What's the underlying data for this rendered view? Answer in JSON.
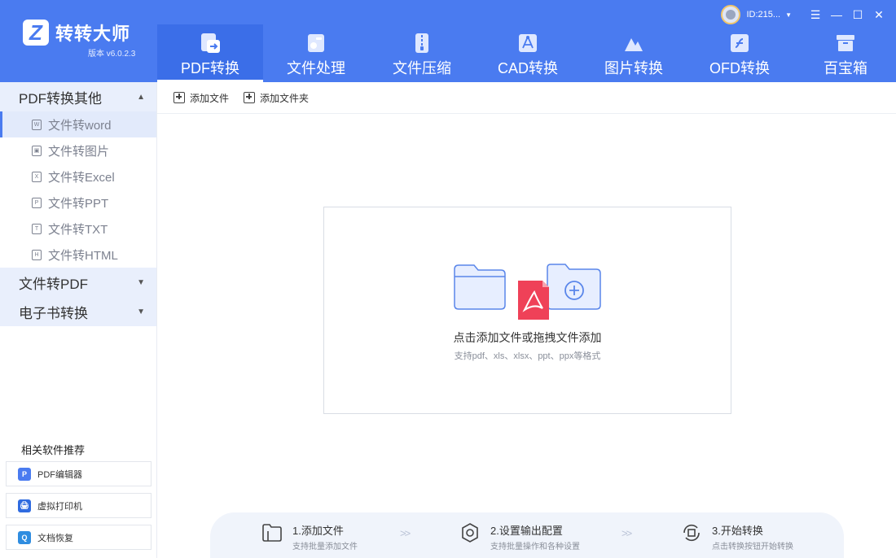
{
  "app": {
    "name": "转转大师",
    "version": "版本 v6.0.2.3"
  },
  "user": {
    "id": "ID:215..."
  },
  "nav": [
    {
      "label": "PDF转换",
      "icon": "pdf-convert-icon",
      "active": true
    },
    {
      "label": "文件处理",
      "icon": "file-process-icon",
      "active": false
    },
    {
      "label": "文件压缩",
      "icon": "file-compress-icon",
      "active": false
    },
    {
      "label": "CAD转换",
      "icon": "cad-convert-icon",
      "active": false
    },
    {
      "label": "图片转换",
      "icon": "image-convert-icon",
      "active": false
    },
    {
      "label": "OFD转换",
      "icon": "ofd-convert-icon",
      "active": false
    },
    {
      "label": "百宝箱",
      "icon": "toolbox-icon",
      "active": false
    }
  ],
  "sidebar": {
    "groups": [
      {
        "label": "PDF转换其他",
        "expanded": true,
        "items": [
          {
            "label": "文件转word",
            "icon": "W",
            "active": true
          },
          {
            "label": "文件转图片",
            "icon": "▣",
            "active": false
          },
          {
            "label": "文件转Excel",
            "icon": "X",
            "active": false
          },
          {
            "label": "文件转PPT",
            "icon": "P",
            "active": false
          },
          {
            "label": "文件转TXT",
            "icon": "T",
            "active": false
          },
          {
            "label": "文件转HTML",
            "icon": "H",
            "active": false
          }
        ]
      },
      {
        "label": "文件转PDF",
        "expanded": false
      },
      {
        "label": "电子书转换",
        "expanded": false
      }
    ],
    "recommend_title": "相关软件推荐",
    "recommend": [
      {
        "label": "PDF编辑器",
        "color": "#4a7bf0",
        "icon": "P"
      },
      {
        "label": "虚拟打印机",
        "color": "#2f6be0",
        "icon": "🖨"
      },
      {
        "label": "文档恢复",
        "color": "#2f8de0",
        "icon": "Q"
      }
    ]
  },
  "toolbar": {
    "add_file": "添加文件",
    "add_folder": "添加文件夹"
  },
  "dropzone": {
    "title": "点击添加文件或拖拽文件添加",
    "subtitle": "支持pdf、xls、xlsx、ppt、ppx等格式"
  },
  "steps": [
    {
      "title": "1.添加文件",
      "desc": "支持批量添加文件"
    },
    {
      "title": "2.设置输出配置",
      "desc": "支持批量操作和各种设置"
    },
    {
      "title": "3.开始转换",
      "desc": "点击转换按钮开始转换"
    }
  ],
  "colors": {
    "brand": "#4a7bf0",
    "pdf_red": "#ef4158"
  }
}
